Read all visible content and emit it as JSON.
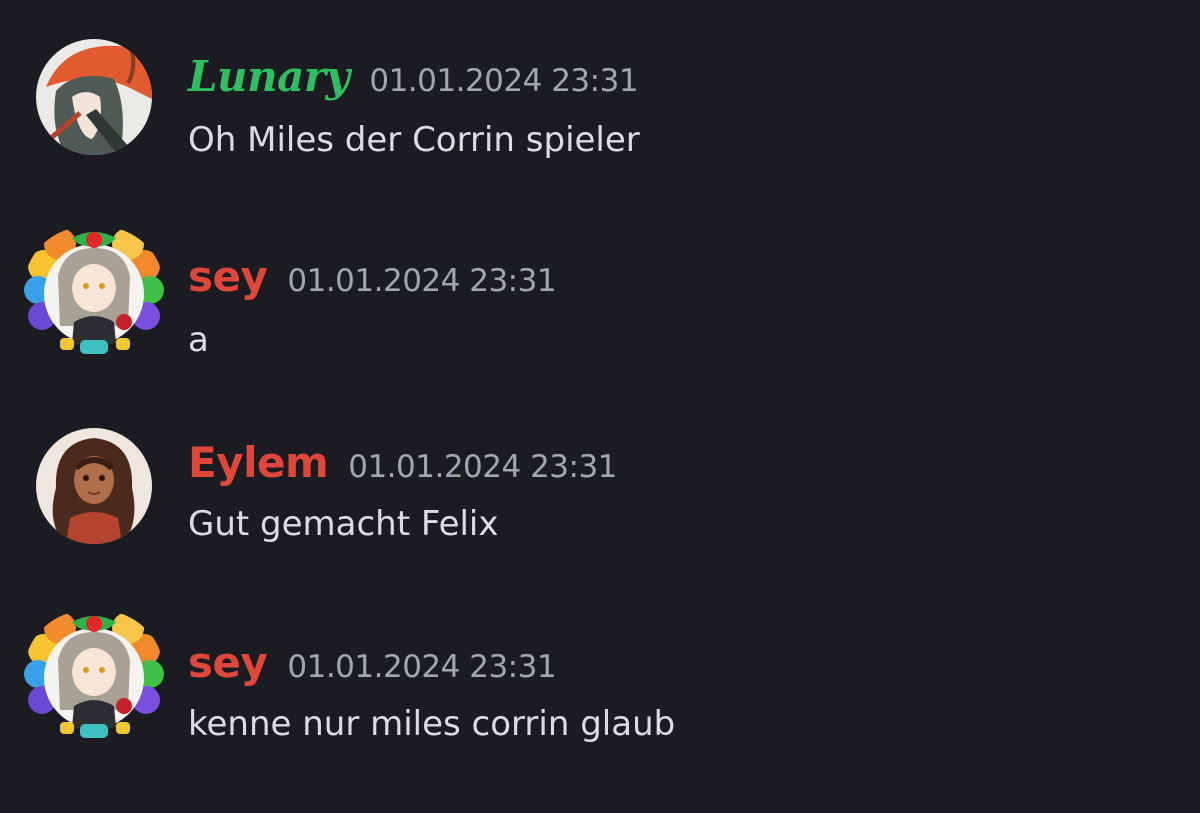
{
  "theme": {
    "background": "#1b1c21",
    "text_color": "#dcdde2",
    "timestamp_color": "#a3a6ae"
  },
  "messages": [
    {
      "username": "Lunary",
      "username_color": "#2fbf62",
      "timestamp": "01.01.2024 23:31",
      "text": "Oh Miles der Corrin spieler",
      "avatar_icon": "anime-character-red-beret-avatar"
    },
    {
      "username": "sey",
      "username_color": "#e0473b",
      "timestamp": "01.01.2024 23:31",
      "text": "a",
      "avatar_icon": "anime-girl-rainbow-frame-avatar"
    },
    {
      "username": "Eylem",
      "username_color": "#e0473b",
      "timestamp": "01.01.2024 23:31",
      "text": "Gut gemacht Felix",
      "avatar_icon": "anime-girl-curly-hair-avatar"
    },
    {
      "username": "sey",
      "username_color": "#e0473b",
      "timestamp": "01.01.2024 23:31",
      "text": "kenne nur miles corrin glaub",
      "avatar_icon": "anime-girl-rainbow-frame-avatar"
    }
  ]
}
